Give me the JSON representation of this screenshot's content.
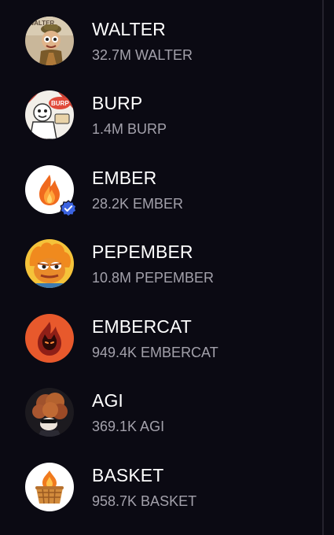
{
  "tokens": [
    {
      "symbol": "WALTER",
      "amount": "32.7M WALTER",
      "icon": "walter-token-icon",
      "verified": false
    },
    {
      "symbol": "BURP",
      "amount": "1.4M BURP",
      "icon": "burp-token-icon",
      "verified": false
    },
    {
      "symbol": "EMBER",
      "amount": "28.2K EMBER",
      "icon": "ember-flame-icon",
      "verified": true
    },
    {
      "symbol": "PEPEMBER",
      "amount": "10.8M PEPEMBER",
      "icon": "pepember-token-icon",
      "verified": false
    },
    {
      "symbol": "EMBERCAT",
      "amount": "949.4K EMBERCAT",
      "icon": "embercat-token-icon",
      "verified": false
    },
    {
      "symbol": "AGI",
      "amount": "369.1K AGI",
      "icon": "agi-token-icon",
      "verified": false
    },
    {
      "symbol": "BASKET",
      "amount": "958.7K BASKET",
      "icon": "basket-token-icon",
      "verified": false
    }
  ],
  "avatar_logo_text": {
    "walter": "WALTER",
    "burp": "BURP"
  },
  "colors": {
    "background": "#0b0a13",
    "primary_text": "#ffffff",
    "secondary_text": "#a3a1ab",
    "verified_badge": "#3b63e0"
  }
}
